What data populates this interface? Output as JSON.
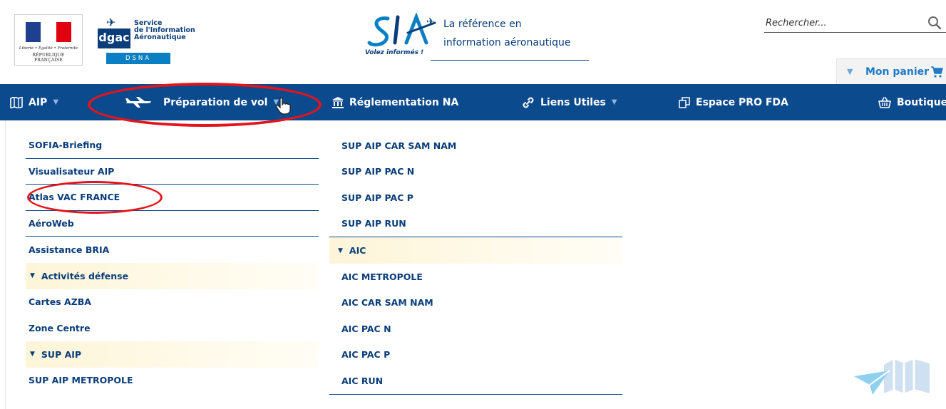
{
  "header": {
    "rf_logo": {
      "motto": "Liberté • Égalité • Fraternité",
      "name": "RÉPUBLIQUE FRANÇAISE"
    },
    "dgac_logo": {
      "mark": "dgac",
      "service_lines": [
        "Service",
        "de l'Information",
        "Aéronautique"
      ],
      "dsna": "DSNA"
    },
    "sia_logo": {
      "wordmark": "SIA",
      "tagline": "Volez informés !",
      "line1": "La référence en",
      "line2": "information aéronautique"
    },
    "search": {
      "placeholder": "Rechercher..."
    },
    "cart": {
      "label": "Mon panier"
    }
  },
  "nav": {
    "items": [
      {
        "label": "AIP",
        "icon": "map-book-icon",
        "has_caret": true
      },
      {
        "label": "Préparation de vol",
        "icon": "airplane-icon",
        "has_caret": true
      },
      {
        "label": "Réglementation NA",
        "icon": "institution-icon",
        "has_caret": false
      },
      {
        "label": "Liens Utiles",
        "icon": "link-icon",
        "has_caret": true
      },
      {
        "label": "Espace PRO FDA",
        "icon": "documents-icon",
        "has_caret": false
      },
      {
        "label": "Boutique",
        "icon": "shop-icon",
        "has_caret": false
      }
    ]
  },
  "dropdown": {
    "column1": {
      "items": [
        "SOFIA-Briefing",
        "Visualisateur AIP",
        "Atlas VAC FRANCE",
        "AéroWeb",
        "Assistance BRIA"
      ],
      "section1": {
        "label": "Activités défense",
        "items": [
          "Cartes AZBA",
          "Zone Centre"
        ]
      },
      "section2": {
        "label": "SUP AIP",
        "items": [
          "SUP AIP METROPOLE"
        ]
      }
    },
    "column2": {
      "items": [
        "SUP AIP CAR SAM NAM",
        "SUP AIP PAC N",
        "SUP AIP PAC P",
        "SUP AIP RUN"
      ],
      "section": {
        "label": "AIC",
        "items": [
          "AIC METROPOLE",
          "AIC CAR SAM NAM",
          "AIC PAC N",
          "AIC PAC P",
          "AIC RUN"
        ]
      }
    }
  },
  "colors": {
    "nav_bg": "#0c4a8e",
    "text": "#0a3d7a",
    "highlight_circle": "#e3141b",
    "section_bg": "#fdf5d8",
    "cart_text": "#1f7ac7"
  }
}
